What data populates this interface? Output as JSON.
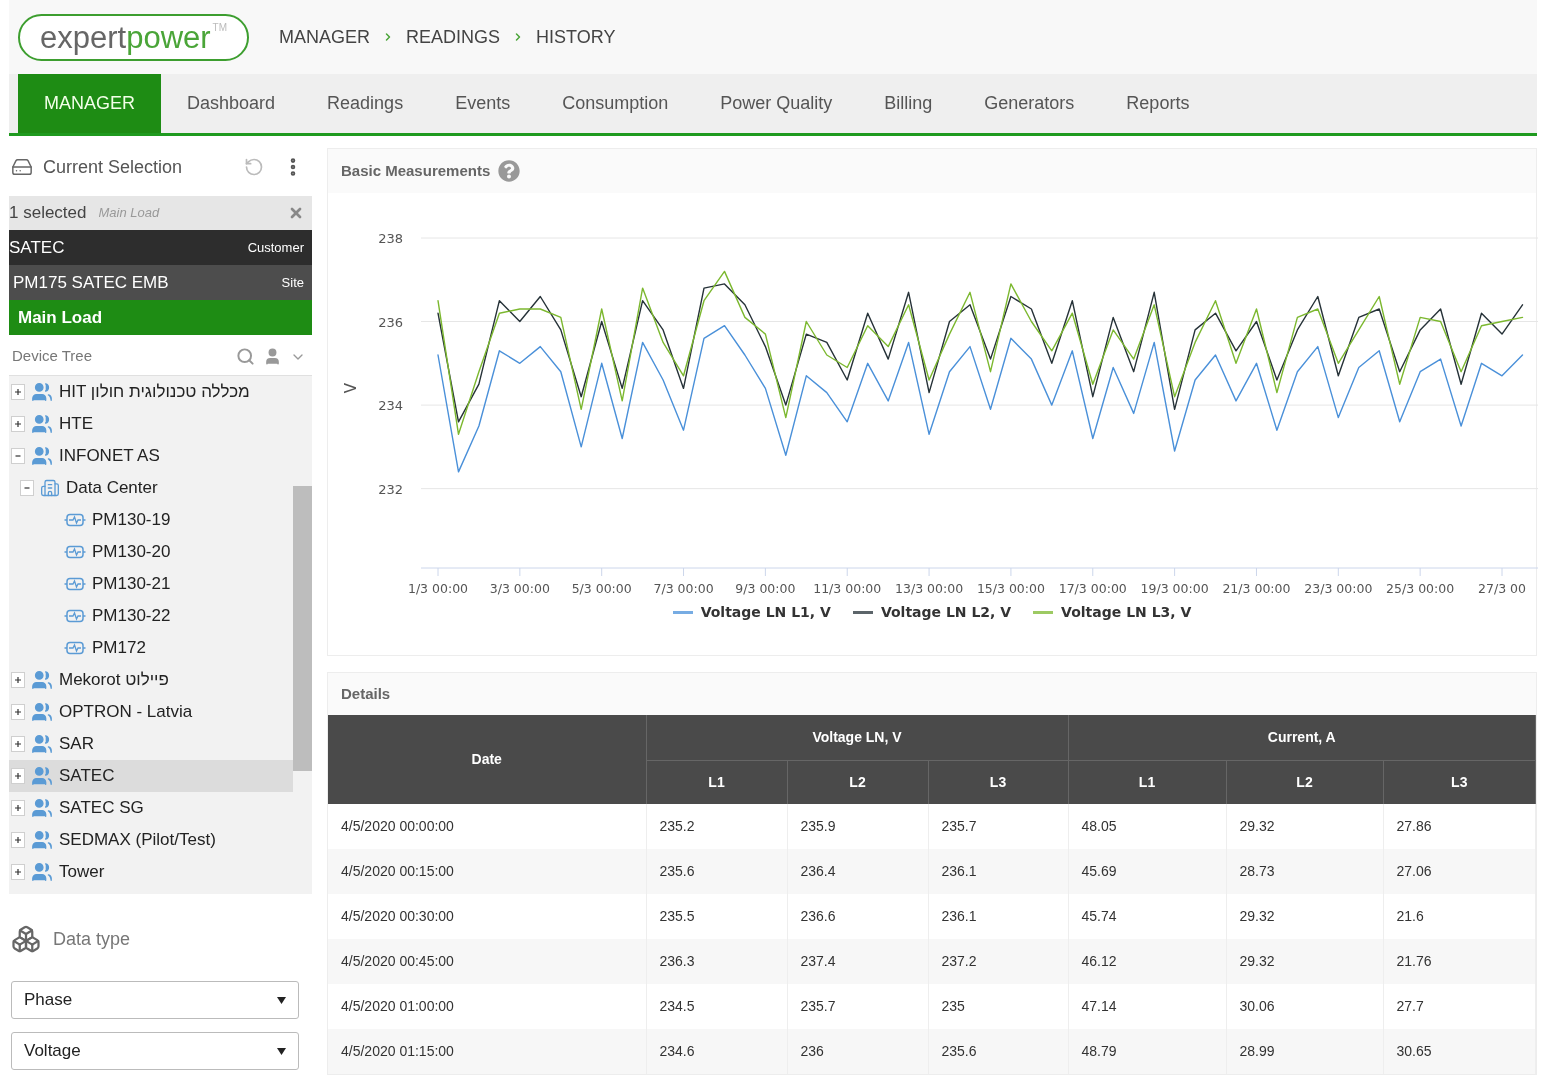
{
  "logo": {
    "text_1": "expert",
    "text_2": "power",
    "mark": "TM"
  },
  "breadcrumb": [
    "MANAGER",
    "READINGS",
    "HISTORY"
  ],
  "nav_tabs": [
    {
      "label": "MANAGER",
      "selected": true
    },
    {
      "label": "Dashboard",
      "selected": false
    },
    {
      "label": "Readings",
      "selected": false
    },
    {
      "label": "Events",
      "selected": false
    },
    {
      "label": "Consumption",
      "selected": false
    },
    {
      "label": "Power Quality",
      "selected": false
    },
    {
      "label": "Billing",
      "selected": false
    },
    {
      "label": "Generators",
      "selected": false
    },
    {
      "label": "Reports",
      "selected": false
    }
  ],
  "sidebar": {
    "current_selection": {
      "title": "Current Selection",
      "count": "1 selected",
      "selected_name": "Main Load",
      "path": [
        {
          "kind": "customer",
          "name": "SATEC",
          "type": "Customer"
        },
        {
          "kind": "site",
          "name": "PM175 SATEC EMB",
          "type": "Site"
        },
        {
          "kind": "load",
          "name": "Main Load"
        }
      ]
    },
    "device_tree": {
      "title": "Device Tree",
      "items": [
        {
          "kind": "group",
          "label": "HIT מכללה טכנולוגית חולון",
          "expanded": false,
          "selected": false
        },
        {
          "kind": "group",
          "label": "HTE",
          "expanded": false,
          "selected": false
        },
        {
          "kind": "group",
          "label": "INFONET AS",
          "expanded": true,
          "selected": false,
          "children": [
            {
              "kind": "site",
              "label": "Data Center",
              "expanded": true,
              "selected": false,
              "children": [
                {
                  "kind": "device",
                  "label": "PM130-19",
                  "selected": false
                },
                {
                  "kind": "device",
                  "label": "PM130-20",
                  "selected": false
                },
                {
                  "kind": "device",
                  "label": "PM130-21",
                  "selected": false
                },
                {
                  "kind": "device",
                  "label": "PM130-22",
                  "selected": false
                },
                {
                  "kind": "device",
                  "label": "PM172",
                  "selected": false
                }
              ]
            }
          ]
        },
        {
          "kind": "group",
          "label": "Mekorot פיילוט",
          "expanded": false,
          "selected": false
        },
        {
          "kind": "group",
          "label": "OPTRON - Latvia",
          "expanded": false,
          "selected": false
        },
        {
          "kind": "group",
          "label": "SAR",
          "expanded": false,
          "selected": false
        },
        {
          "kind": "group",
          "label": "SATEC",
          "expanded": false,
          "selected": true
        },
        {
          "kind": "group",
          "label": "SATEC SG",
          "expanded": false,
          "selected": false
        },
        {
          "kind": "group",
          "label": "SEDMAX (Pilot/Test)",
          "expanded": false,
          "selected": false
        },
        {
          "kind": "group",
          "label": "Tower",
          "expanded": false,
          "selected": false
        }
      ]
    },
    "data_type": {
      "title": "Data type",
      "selects": [
        {
          "value": "Phase"
        },
        {
          "value": "Voltage"
        }
      ]
    }
  },
  "chart_card": {
    "title": "Basic Measurements",
    "chart_data": {
      "type": "line",
      "ylabel": "V",
      "grid": true,
      "ylim": [
        230.1,
        238
      ],
      "yticks": [
        232,
        234,
        236,
        238
      ],
      "categories": [
        "1/3 00:00",
        null,
        null,
        null,
        "3/3 00:00",
        null,
        null,
        null,
        "5/3 00:00",
        null,
        null,
        null,
        "7/3 00:00",
        null,
        null,
        null,
        "9/3 00:00",
        null,
        null,
        null,
        "11/3 00:00",
        null,
        null,
        null,
        "13/3 00:00",
        null,
        null,
        null,
        "15/3 00:00",
        null,
        null,
        null,
        "17/3 00:00",
        null,
        null,
        null,
        "19/3 00:00",
        null,
        null,
        null,
        "21/3 00:00",
        null,
        null,
        null,
        "23/3 00:00",
        null,
        null,
        null,
        "25/3 00:00",
        null,
        null,
        null,
        "27/3 00",
        null
      ],
      "series": [
        {
          "name": "Voltage LN L1, V",
          "color": "#4a90d9",
          "values": [
            235.2,
            232.4,
            233.5,
            235.3,
            235.0,
            235.4,
            234.8,
            233.0,
            235.0,
            233.2,
            235.5,
            234.6,
            233.4,
            235.6,
            235.9,
            235.2,
            234.4,
            232.8,
            234.7,
            234.3,
            233.6,
            235.0,
            234.1,
            235.5,
            233.3,
            234.8,
            235.4,
            233.9,
            235.6,
            235.1,
            234.0,
            235.3,
            233.2,
            234.9,
            233.8,
            235.5,
            232.9,
            234.6,
            235.2,
            234.1,
            235.0,
            233.4,
            234.8,
            235.4,
            233.7,
            234.9,
            235.3,
            233.6,
            234.8,
            235.1,
            233.5,
            235.0,
            234.7,
            235.2
          ]
        },
        {
          "name": "Voltage LN L2, V",
          "color": "#263238",
          "values": [
            236.2,
            233.6,
            234.5,
            236.5,
            236.0,
            236.6,
            235.8,
            234.2,
            236.0,
            234.4,
            236.5,
            235.8,
            234.4,
            236.8,
            236.9,
            236.4,
            235.4,
            234.0,
            235.7,
            235.5,
            234.6,
            236.2,
            235.1,
            236.7,
            234.3,
            236.0,
            236.4,
            235.1,
            236.6,
            236.3,
            235.0,
            236.5,
            234.2,
            236.1,
            234.8,
            236.7,
            233.9,
            235.8,
            236.2,
            235.3,
            236.0,
            234.6,
            235.8,
            236.6,
            234.7,
            236.1,
            236.3,
            234.8,
            235.8,
            236.3,
            234.5,
            236.2,
            235.7,
            236.4
          ]
        },
        {
          "name": "Voltage LN L3, V",
          "color": "#7cb82f",
          "values": [
            236.5,
            233.3,
            234.8,
            236.2,
            236.3,
            236.3,
            236.1,
            233.9,
            236.3,
            234.1,
            236.8,
            235.5,
            234.7,
            236.5,
            237.2,
            236.1,
            235.7,
            233.7,
            236.0,
            235.2,
            234.9,
            235.9,
            235.4,
            236.4,
            234.6,
            235.7,
            236.7,
            234.8,
            236.9,
            236.0,
            235.3,
            236.2,
            234.5,
            235.8,
            235.1,
            236.4,
            234.2,
            235.5,
            236.5,
            235.0,
            236.3,
            234.3,
            236.1,
            236.3,
            235.0,
            235.8,
            236.6,
            234.5,
            236.1,
            236.0,
            234.8,
            235.9,
            236.0,
            236.1
          ]
        }
      ]
    }
  },
  "details": {
    "title": "Details",
    "table": {
      "date_column": "Date",
      "groups": [
        {
          "label": "Voltage LN, V",
          "columns": [
            "L1",
            "L2",
            "L3"
          ]
        },
        {
          "label": "Current, A",
          "columns": [
            "L1",
            "L2",
            "L3"
          ]
        }
      ],
      "rows": [
        [
          "4/5/2020 00:00:00",
          "235.2",
          "235.9",
          "235.7",
          "48.05",
          "29.32",
          "27.86"
        ],
        [
          "4/5/2020 00:15:00",
          "235.6",
          "236.4",
          "236.1",
          "45.69",
          "28.73",
          "27.06"
        ],
        [
          "4/5/2020 00:30:00",
          "235.5",
          "236.6",
          "236.1",
          "45.74",
          "29.32",
          "21.6"
        ],
        [
          "4/5/2020 00:45:00",
          "236.3",
          "237.4",
          "237.2",
          "46.12",
          "29.32",
          "21.76"
        ],
        [
          "4/5/2020 01:00:00",
          "234.5",
          "235.7",
          "235",
          "47.14",
          "30.06",
          "27.7"
        ],
        [
          "4/5/2020 01:15:00",
          "234.6",
          "236",
          "235.6",
          "48.79",
          "28.99",
          "30.65"
        ]
      ]
    }
  }
}
